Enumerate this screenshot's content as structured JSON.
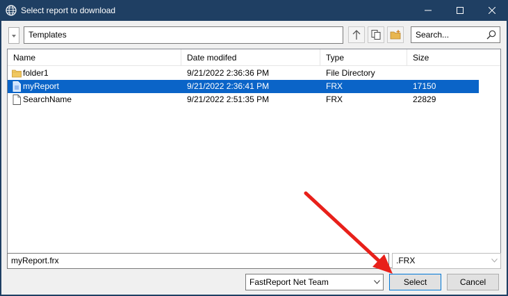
{
  "window": {
    "title": "Select report to download",
    "app_icon": "globe-icon",
    "controls": [
      "minimize-icon",
      "maximize-icon",
      "close-icon"
    ]
  },
  "toolbar": {
    "path": "Templates",
    "up_icon": "arrow-up-icon",
    "copy_icon": "copy-icon",
    "new_folder_icon": "new-folder-icon",
    "search_placeholder": "Search...",
    "search_icon": "search-icon"
  },
  "filelist": {
    "columns": [
      "Name",
      "Date modifed",
      "Type",
      "Size"
    ],
    "rows": [
      {
        "name": "folder1",
        "date": "9/21/2022 2:36:36 PM",
        "type": "File Directory",
        "size": "",
        "icon": "folder-icon",
        "selected": false
      },
      {
        "name": "myReport",
        "date": "9/21/2022 2:36:41 PM",
        "type": "FRX",
        "size": "17150",
        "icon": "document-icon",
        "selected": true
      },
      {
        "name": "SearchName",
        "date": "9/21/2022 2:51:35 PM",
        "type": "FRX",
        "size": "22829",
        "icon": "document-icon",
        "selected": false
      }
    ]
  },
  "bottom": {
    "filename": "myReport.frx",
    "filter": ".FRX",
    "team": "FastReport Net Team",
    "select_label": "Select",
    "cancel_label": "Cancel"
  },
  "colors": {
    "titlebar": "#1f3f63",
    "selection": "#0a64c8",
    "annotation_arrow": "#e8201a"
  }
}
